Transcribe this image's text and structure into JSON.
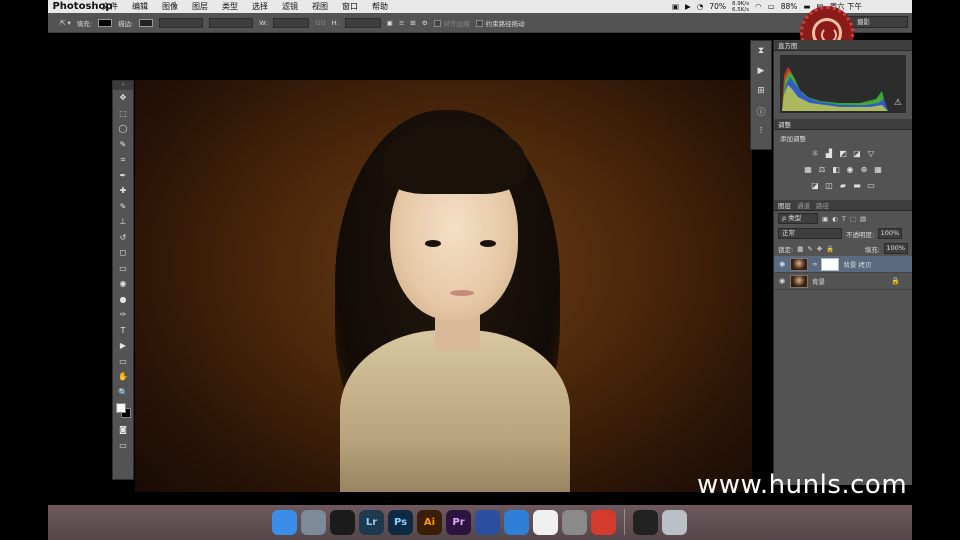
{
  "menubar": {
    "apple_glyph": "",
    "items": [
      "Photoshop",
      "文件",
      "编辑",
      "图像",
      "图层",
      "类型",
      "选择",
      "滤镜",
      "视图",
      "窗口",
      "帮助"
    ],
    "net_up": "8.9K/s",
    "net_down": "6.5K/s",
    "battery_left": "70%",
    "battery_right": "88%",
    "clock": "周六 下午"
  },
  "options": {
    "fill_label": "填充:",
    "stroke_label": "描边:",
    "w_label": "W:",
    "link_glyph": "GO",
    "h_label": "H:",
    "align_edges": "对齐边缘",
    "constrain_path": "约束路径拖动",
    "workspace": "摄影"
  },
  "tools": {
    "icons": [
      "move-tool",
      "marquee-tool",
      "lasso-tool",
      "quick-select-tool",
      "crop-tool",
      "eyedropper-tool",
      "healing-tool",
      "brush-tool",
      "stamp-tool",
      "history-brush-tool",
      "eraser-tool",
      "gradient-tool",
      "blur-tool",
      "dodge-tool",
      "pen-tool",
      "type-tool",
      "path-select-tool",
      "rectangle-tool",
      "hand-tool",
      "zoom-tool"
    ],
    "glyphs": [
      "✥",
      "⬚",
      "◯",
      "✎",
      "⌗",
      "✒",
      "✚",
      "✎",
      "⊥",
      "↺",
      "◻",
      "▭",
      "◉",
      "●",
      "✑",
      "T",
      "▶",
      "▭",
      "✋",
      "🔍"
    ]
  },
  "panels": {
    "histogram_tab": "直方图",
    "adjustments_tab": "调整",
    "add_adjustment": "添加调整",
    "layers_tab": "图层",
    "channels_tab": "通道",
    "paths_tab": "路径",
    "kind_filter": "类型",
    "blend_mode": "正常",
    "opacity_label": "不透明度:",
    "opacity_value": "100%",
    "lock_label": "锁定:",
    "fill_label": "填充:",
    "fill_value": "100%",
    "layers": [
      {
        "name": "背景 拷贝",
        "active": true
      },
      {
        "name": "背景",
        "active": false
      }
    ]
  },
  "dock": {
    "apps": [
      {
        "id": "finder",
        "label": "",
        "color": "#3b8ee8"
      },
      {
        "id": "launchpad",
        "label": "",
        "color": "#7c8a99"
      },
      {
        "id": "qq",
        "label": "",
        "color": "#1b1b1b"
      },
      {
        "id": "lightroom",
        "label": "Lr",
        "color": "#1f3a4f"
      },
      {
        "id": "photoshop",
        "label": "Ps",
        "color": "#0f2a44"
      },
      {
        "id": "illustrator",
        "label": "Ai",
        "color": "#3a1e05"
      },
      {
        "id": "premiere",
        "label": "Pr",
        "color": "#2b1440"
      },
      {
        "id": "news",
        "label": "",
        "color": "#2a4fa0"
      },
      {
        "id": "cloud",
        "label": "",
        "color": "#2f7fd8"
      },
      {
        "id": "photos",
        "label": "",
        "color": "#f0f0f0"
      },
      {
        "id": "system-prefs",
        "label": "",
        "color": "#8a8a8a"
      },
      {
        "id": "netease-music",
        "label": "",
        "color": "#d43a2e"
      },
      {
        "id": "display",
        "label": "",
        "color": "#222"
      },
      {
        "id": "trash",
        "label": "",
        "color": "#b9c0c7"
      }
    ]
  },
  "watermark": "www.hunls.com"
}
